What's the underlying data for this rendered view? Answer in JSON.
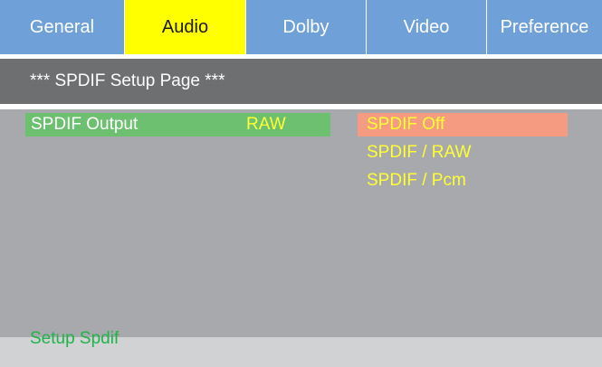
{
  "tabs": [
    {
      "label": "General",
      "active": false
    },
    {
      "label": "Audio",
      "active": true
    },
    {
      "label": "Dolby",
      "active": false
    },
    {
      "label": "Video",
      "active": false
    },
    {
      "label": "Preference",
      "active": false
    }
  ],
  "page": {
    "title": "*** SPDIF Setup Page ***"
  },
  "setting": {
    "label": "SPDIF Output",
    "value": "RAW"
  },
  "options": [
    {
      "label": "SPDIF Off",
      "selected": true
    },
    {
      "label": "SPDIF / RAW",
      "selected": false
    },
    {
      "label": "SPDIF / Pcm",
      "selected": false
    }
  ],
  "footer": {
    "hint": "Setup Spdif"
  },
  "colors": {
    "tab_bg": "#6fa1d8",
    "tab_active_bg": "#ffff00",
    "header_bg": "#6e6f71",
    "content_bg": "#a7a9ac",
    "row_highlight": "#6cc070",
    "option_selected_bg": "#f59b81",
    "value_text": "#ffff33",
    "hint_text": "#1fb34a"
  }
}
